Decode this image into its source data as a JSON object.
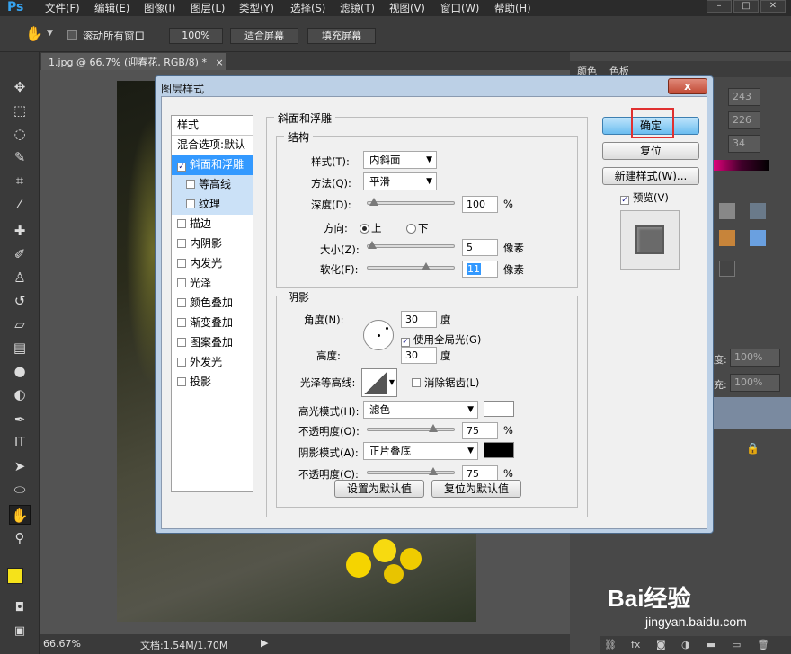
{
  "app": {
    "logo": "Ps",
    "menu": [
      "文件(F)",
      "编辑(E)",
      "图像(I)",
      "图层(L)",
      "类型(Y)",
      "选择(S)",
      "滤镜(T)",
      "视图(V)",
      "窗口(W)",
      "帮助(H)"
    ]
  },
  "options_bar": {
    "scroll_all": "滚动所有窗口",
    "zoom_100": "100%",
    "fit_screen": "适合屏幕",
    "fill_screen": "填充屏幕"
  },
  "document": {
    "tab_title": "1.jpg @ 66.7% (迎春花, RGB/8) *",
    "tab_close": "×"
  },
  "status": {
    "zoom": "66.67%",
    "doc_info": "文档:1.54M/1.70M"
  },
  "right_panel": {
    "tab_color": "颜色",
    "tab_swatches": "色板",
    "val1": "243",
    "val2": "226",
    "val3": "34",
    "opacity_label": "度:",
    "opacity_val": "100%",
    "fill_label": "充:",
    "fill_val": "100%"
  },
  "dialog": {
    "title": "图层样式",
    "close": "x",
    "styles_header": "样式",
    "blend_options": "混合选项:默认",
    "items": [
      {
        "label": "斜面和浮雕",
        "checked": true,
        "selected": true
      },
      {
        "label": "等高线",
        "checked": false,
        "sub": true
      },
      {
        "label": "纹理",
        "checked": false,
        "sub": true
      },
      {
        "label": "描边",
        "checked": false
      },
      {
        "label": "内阴影",
        "checked": false
      },
      {
        "label": "内发光",
        "checked": false
      },
      {
        "label": "光泽",
        "checked": false
      },
      {
        "label": "颜色叠加",
        "checked": false
      },
      {
        "label": "渐变叠加",
        "checked": false
      },
      {
        "label": "图案叠加",
        "checked": false
      },
      {
        "label": "外发光",
        "checked": false
      },
      {
        "label": "投影",
        "checked": false
      }
    ],
    "bevel": {
      "group_title": "斜面和浮雕",
      "structure_title": "结构",
      "style_label": "样式(T):",
      "style_value": "内斜面",
      "technique_label": "方法(Q):",
      "technique_value": "平滑",
      "depth_label": "深度(D):",
      "depth_value": "100",
      "depth_unit": "%",
      "direction_label": "方向:",
      "direction_up": "上",
      "direction_down": "下",
      "size_label": "大小(Z):",
      "size_value": "5",
      "size_unit": "像素",
      "soften_label": "软化(F):",
      "soften_value": "11",
      "soften_unit": "像素"
    },
    "shading": {
      "title": "阴影",
      "angle_label": "角度(N):",
      "angle_value": "30",
      "angle_unit": "度",
      "global_light": "使用全局光(G)",
      "altitude_label": "高度:",
      "altitude_value": "30",
      "altitude_unit": "度",
      "gloss_label": "光泽等高线:",
      "antialias": "消除锯齿(L)",
      "highlight_label": "高光模式(H):",
      "highlight_value": "滤色",
      "highlight_color": "#ffffff",
      "opacity1_label": "不透明度(O):",
      "opacity1_value": "75",
      "opacity1_unit": "%",
      "shadow_label": "阴影模式(A):",
      "shadow_value": "正片叠底",
      "shadow_color": "#000000",
      "opacity2_label": "不透明度(C):",
      "opacity2_value": "75",
      "opacity2_unit": "%"
    },
    "set_default": "设置为默认值",
    "reset_default": "复位为默认值",
    "ok": "确定",
    "reset": "复位",
    "new_style": "新建样式(W)...",
    "preview": "预览(V)"
  },
  "watermark": {
    "text": "Bai经验",
    "url": "jingyan.baidu.com"
  }
}
